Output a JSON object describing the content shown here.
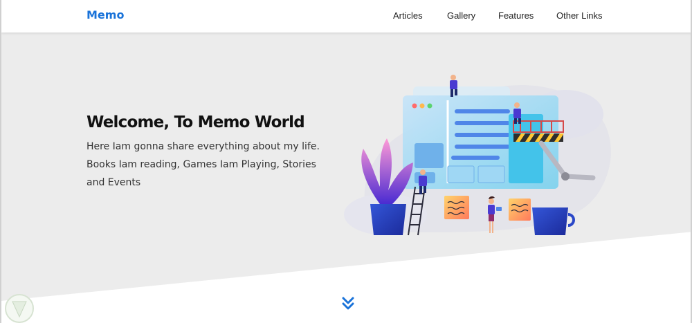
{
  "header": {
    "brand": "Memo",
    "nav": [
      {
        "label": "Articles"
      },
      {
        "label": "Gallery"
      },
      {
        "label": "Features"
      },
      {
        "label": "Other Links"
      }
    ]
  },
  "hero": {
    "title": "Welcome, To Memo World",
    "description": "Here Iam gonna share everything about my life. Books Iam reading, Games Iam Playing, Stories and Events"
  },
  "scroll": {
    "icon": "double-chevron-down-icon"
  },
  "colors": {
    "brand": "#1a73d9",
    "hero_bg": "#ececec",
    "text": "#111111"
  }
}
